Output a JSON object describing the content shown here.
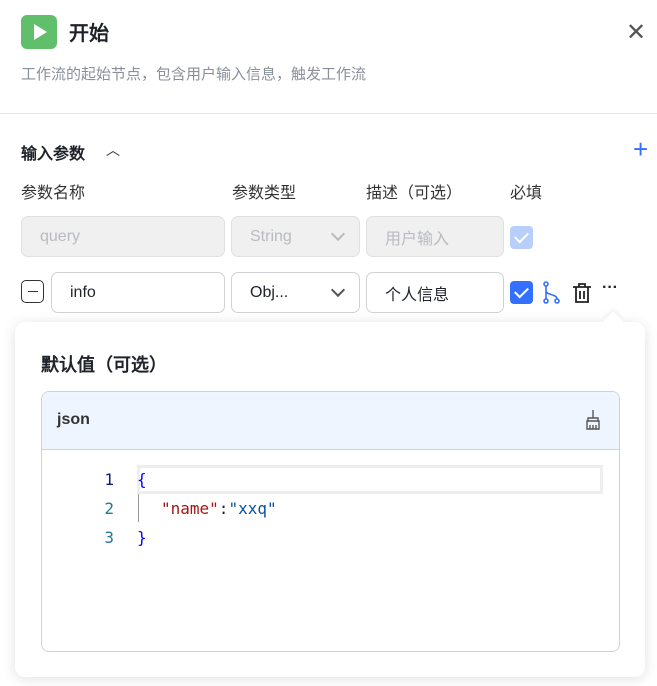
{
  "header": {
    "title": "开始",
    "description": "工作流的起始节点，包含用户输入信息，触发工作流",
    "icon": "play-icon"
  },
  "section": {
    "title": "输入参数",
    "columns": [
      "参数名称",
      "参数类型",
      "描述（可选）",
      "必填"
    ]
  },
  "params": [
    {
      "name": "query",
      "type": "String",
      "description": "用户输入",
      "required": true,
      "disabled": true
    },
    {
      "name": "info",
      "type": "Obj...",
      "description": "个人信息",
      "required": true,
      "disabled": false
    }
  ],
  "popover": {
    "title": "默认值（可选）",
    "language": "json",
    "lines": [
      {
        "num": "1",
        "text": "{"
      },
      {
        "num": "2",
        "key": "\"name\"",
        "colon": ":",
        "value": "\"xxq\""
      },
      {
        "num": "3",
        "text": "}"
      }
    ]
  },
  "colors": {
    "accent": "#3370ff",
    "logo": "#5fbf6a",
    "editor_header": "#eef5fe"
  }
}
